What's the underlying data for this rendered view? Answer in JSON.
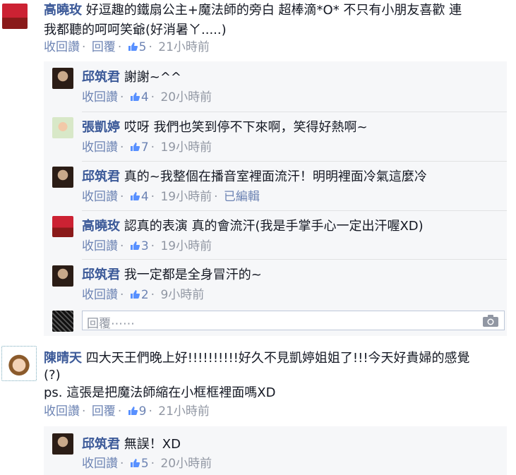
{
  "thread": {
    "c1": {
      "author": "高曉玫",
      "text_line1": "好逗趣的鐵扇公主+魔法師的旁白 超棒滴*O* 不只有小朋友喜歡 連",
      "text_line2": "我都聽的呵呵笑爺(好消暑ㄚ.....)",
      "unlike": "收回讚",
      "reply": "回覆",
      "likes": "5",
      "time": "21小時前"
    },
    "r1": {
      "author": "邱筑君",
      "text": "謝謝~^^",
      "unlike": "收回讚",
      "likes": "4",
      "time": "20小時前"
    },
    "r2": {
      "author": "張凱婷",
      "text": "哎呀 我們也笑到停不下來啊，笑得好熱啊~",
      "unlike": "收回讚",
      "likes": "7",
      "time": "19小時前"
    },
    "r3": {
      "author": "邱筑君",
      "text": "真的~我整個在播音室裡面流汗！明明裡面冷氣這麼冷",
      "unlike": "收回讚",
      "likes": "4",
      "time": "19小時前",
      "edited": "已編輯"
    },
    "r4": {
      "author": "高曉玫",
      "text": "認真的表演 真的會流汗(我是手掌手心一定出汗喔XD)",
      "unlike": "收回讚",
      "likes": "3",
      "time": "19小時前"
    },
    "r5": {
      "author": "邱筑君",
      "text": "我一定都是全身冒汗的~",
      "unlike": "收回讚",
      "likes": "2",
      "time": "9小時前"
    },
    "reply_placeholder": "回覆⋯⋯",
    "c2": {
      "author": "陳晴天",
      "text_line1": "四大天王們晚上好!!!!!!!!!!好久不見凱婷姐姐了!!!今天好貴婦的感覺",
      "text_line2": "(?)",
      "text_line3": "ps. 這張是把魔法師縮在小框框裡面嗎XD",
      "unlike": "收回讚",
      "reply": "回覆",
      "likes": "9",
      "time": "21小時前"
    },
    "r6": {
      "author": "邱筑君",
      "text": "無誤！XD",
      "unlike": "收回讚",
      "likes": "5",
      "time": "20小時前"
    }
  },
  "colors": {
    "name": "#3b5998",
    "link": "#6d84b4",
    "meta": "#9197a3",
    "reply_bg": "#f6f7f9"
  }
}
